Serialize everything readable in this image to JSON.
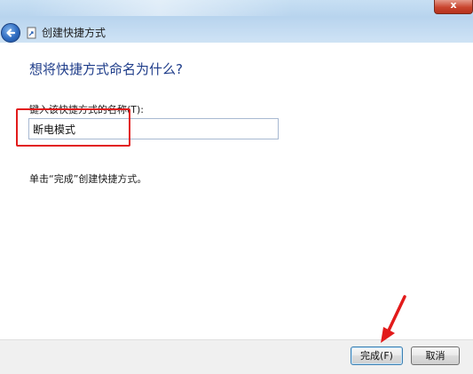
{
  "window": {
    "title": "创建快捷方式",
    "close_symbol": "x",
    "back_icon": "back-arrow-icon",
    "wizard_icon": "shortcut-wizard-icon"
  },
  "main": {
    "heading": "想将快捷方式命名为什么?",
    "field_label": "键入该快捷方式的名称(T):",
    "name_value": "断电模式",
    "instruction": "单击“完成”创建快捷方式。"
  },
  "buttons": {
    "finish": "完成(F)",
    "cancel": "取消"
  },
  "colors": {
    "heading": "#1f3d8a",
    "annotation": "#e21b1b"
  }
}
